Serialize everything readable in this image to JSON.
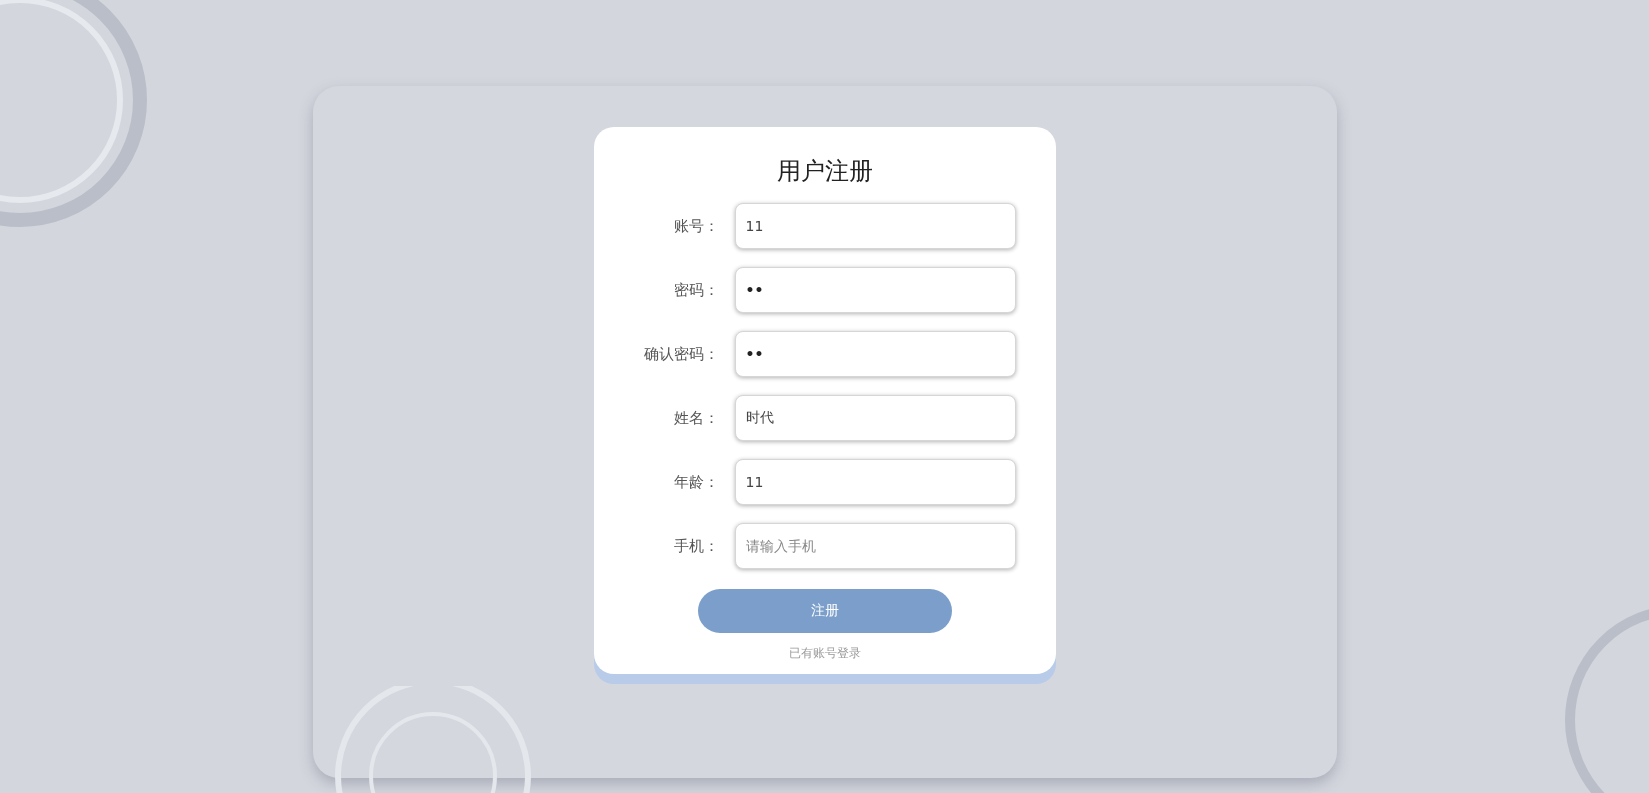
{
  "form": {
    "title": "用户注册",
    "fields": [
      {
        "label": "账号：",
        "kind": "text",
        "value": "11"
      },
      {
        "label": "密码：",
        "kind": "password",
        "value": "••"
      },
      {
        "label": "确认密码：",
        "kind": "password",
        "value": "••"
      },
      {
        "label": "姓名：",
        "kind": "text",
        "value": "时代"
      },
      {
        "label": "年龄：",
        "kind": "text",
        "value": "11"
      },
      {
        "label": "手机：",
        "kind": "text",
        "placeholder": "请输入手机"
      }
    ],
    "submit": "注册",
    "login_link": "已有账号登录"
  }
}
